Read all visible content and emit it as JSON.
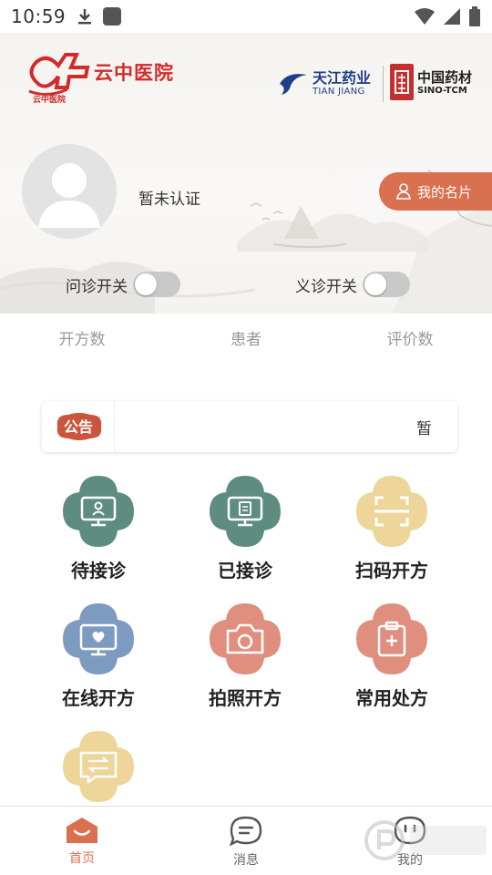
{
  "status_bar": {
    "time": "10:59",
    "icons_left": [
      "download-icon",
      "app-icon"
    ],
    "icons_right": [
      "wifi-icon",
      "signal-icon",
      "battery-icon"
    ]
  },
  "header": {
    "brand_name": "云中医院",
    "brand_small": "云中医院",
    "partner1_cn": "天江药业",
    "partner1_en": "TIAN JIANG",
    "partner2_cn": "中国药材",
    "partner2_en": "SINO-TCM",
    "cert_status": "暂未认证",
    "card_button_label": "我的名片"
  },
  "toggles": [
    {
      "label": "问诊开关",
      "on": false
    },
    {
      "label": "义诊开关",
      "on": false
    }
  ],
  "stats": [
    "开方数",
    "患者",
    "评价数"
  ],
  "notice": {
    "badge": "公告",
    "text": "暂"
  },
  "grid": [
    {
      "label": "待接诊",
      "icon": "pending-consult-icon",
      "color": "#5e8c80"
    },
    {
      "label": "已接诊",
      "icon": "accepted-consult-icon",
      "color": "#5e8c80"
    },
    {
      "label": "扫码开方",
      "icon": "scan-icon",
      "color": "#eed59a"
    },
    {
      "label": "在线开方",
      "icon": "online-prescribe-icon",
      "color": "#7d9bc0"
    },
    {
      "label": "拍照开方",
      "icon": "camera-icon",
      "color": "#e08f7e"
    },
    {
      "label": "常用处方",
      "icon": "clipboard-plus-icon",
      "color": "#e08f7e"
    },
    {
      "label": "",
      "icon": "chat-transfer-icon",
      "color": "#eed59a"
    }
  ],
  "bottom_nav": [
    {
      "label": "首页",
      "icon": "home-icon",
      "active": true
    },
    {
      "label": "消息",
      "icon": "message-icon",
      "active": false
    },
    {
      "label": "我的",
      "icon": "profile-icon",
      "active": false
    }
  ],
  "colors": {
    "accent": "#d9704f",
    "brand_red": "#d42a2a",
    "teal": "#5e8c80",
    "gold": "#eed59a",
    "blue": "#7d9bc0",
    "coral": "#e08f7e"
  }
}
